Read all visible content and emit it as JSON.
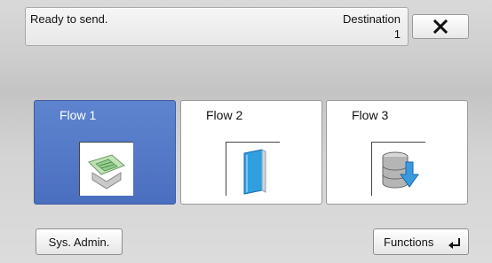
{
  "status": {
    "text": "Ready to send.",
    "destination_label": "Destination",
    "destination_count": "1"
  },
  "close_icon": "close-icon",
  "flows": [
    {
      "label": "Flow 1",
      "icon": "scanner-icon",
      "selected": true
    },
    {
      "label": "Flow 2",
      "icon": "book-icon",
      "selected": false
    },
    {
      "label": "Flow 3",
      "icon": "database-download-icon",
      "selected": false
    }
  ],
  "footer": {
    "sys_admin_label": "Sys. Admin.",
    "functions_label": "Functions",
    "functions_icon": "enter-arrow-icon"
  },
  "colors": {
    "selected_tile": "#5475c7",
    "background": "#d2d2d2"
  }
}
